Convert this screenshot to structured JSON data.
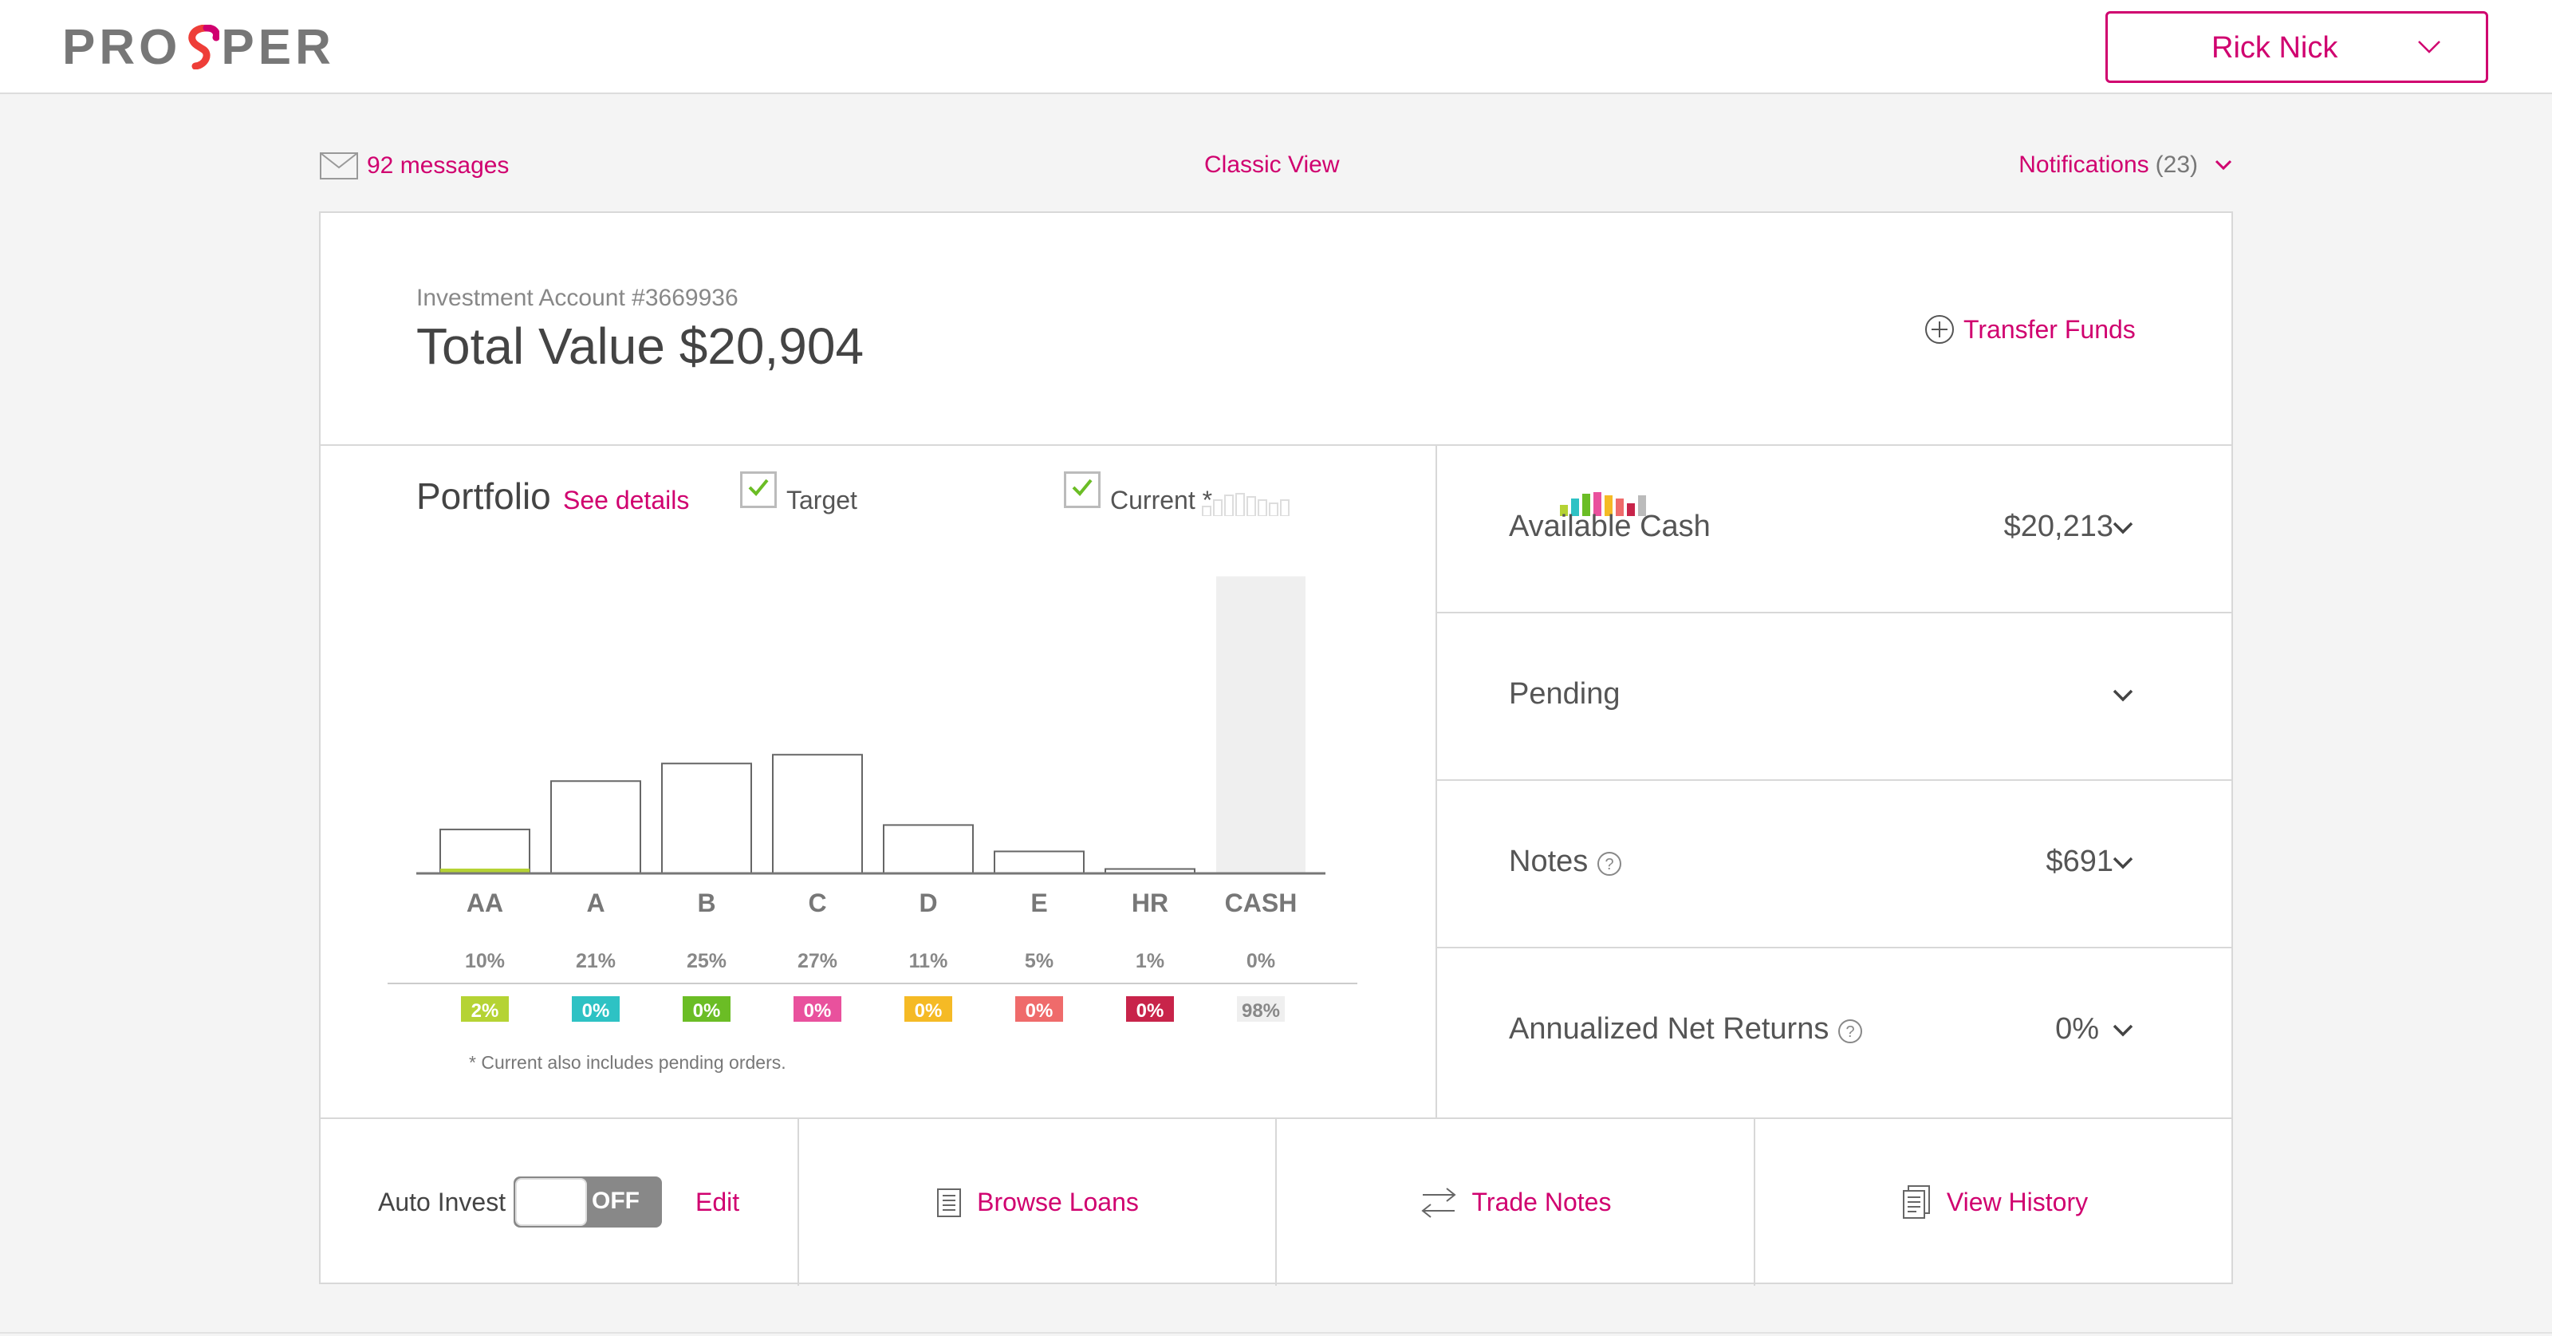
{
  "header": {
    "logo_left": "PRO",
    "logo_right": "PER",
    "user_name": "Rick Nick"
  },
  "topbar": {
    "messages": "92 messages",
    "classic_view": "Classic View",
    "notifications_label": "Notifications",
    "notifications_count": "(23)"
  },
  "account": {
    "number_label": "Investment Account #3669936",
    "total_label": "Total Value $20,904",
    "transfer_label": "Transfer Funds"
  },
  "portfolio": {
    "title": "Portfolio",
    "see_details": "See details",
    "target_label": "Target",
    "current_label": "Current *",
    "footnote": "* Current also includes pending orders."
  },
  "chart_data": {
    "type": "bar",
    "categories": [
      "AA",
      "A",
      "B",
      "C",
      "D",
      "E",
      "HR",
      "CASH"
    ],
    "target_labels": [
      "10%",
      "21%",
      "25%",
      "27%",
      "11%",
      "5%",
      "1%",
      "0%"
    ],
    "current_labels": [
      "2%",
      "0%",
      "0%",
      "0%",
      "0%",
      "0%",
      "0%",
      "98%"
    ],
    "target_values": [
      10,
      21,
      25,
      27,
      11,
      5,
      1,
      0
    ],
    "current_values": [
      2,
      0,
      0,
      0,
      0,
      0,
      0,
      98
    ],
    "colors": [
      "#b5d334",
      "#2ec2c4",
      "#6bbd25",
      "#e9519d",
      "#f5ba25",
      "#ef6b6b",
      "#c8244a",
      "#efefef"
    ],
    "ylim": [
      0,
      100
    ]
  },
  "summary": {
    "available_cash_label": "Available Cash",
    "available_cash_value": "$20,213",
    "pending_label": "Pending",
    "notes_label": "Notes",
    "notes_value": "$691",
    "returns_label": "Annualized Net Returns",
    "returns_value": "0%"
  },
  "actions": {
    "auto_invest_label": "Auto Invest",
    "toggle_state": "OFF",
    "edit_label": "Edit",
    "browse_loans": "Browse Loans",
    "trade_notes": "Trade Notes",
    "view_history": "View History"
  },
  "colors": {
    "accent": "#d0006f"
  }
}
